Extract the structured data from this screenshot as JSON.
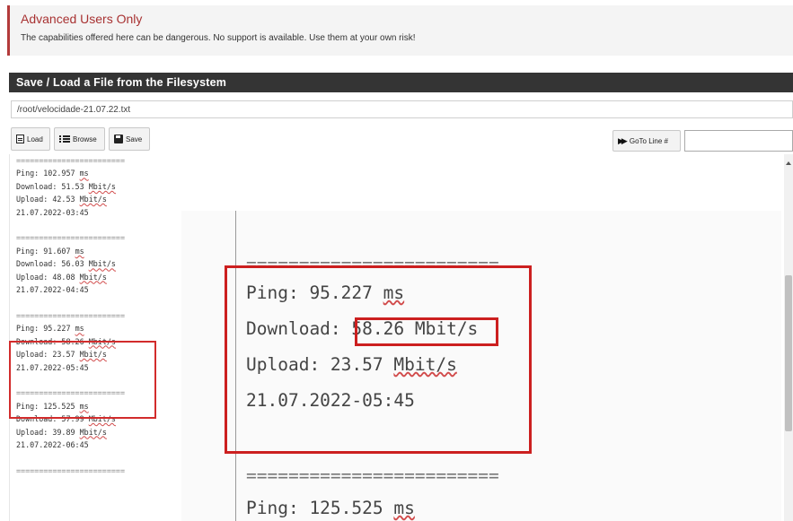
{
  "warning": {
    "title": "Advanced Users Only",
    "text": "The capabilities offered here can be dangerous. No support is available. Use them at your own risk!"
  },
  "panel": {
    "title": "Save / Load a File from the Filesystem"
  },
  "file_path": "/root/velocidade-21.07.22.txt",
  "toolbar": {
    "load_label": "Load",
    "browse_label": "Browse",
    "save_label": "Save",
    "goto_label": "GoTo Line #",
    "goto_value": ""
  },
  "editor": {
    "separator": "========================",
    "entries": [
      {
        "ping": "Ping: 102.957",
        "download": "Download: 51.53",
        "upload": "Upload: 42.53",
        "date": "21.07.2022-03:45"
      },
      {
        "ping": "Ping: 91.607",
        "download": "Download: 56.03",
        "upload": "Upload: 48.08",
        "date": "21.07.2022-04:45"
      },
      {
        "ping": "Ping: 95.227",
        "download": "Download: 58.26",
        "upload": "Upload: 23.57",
        "date": "21.07.2022-05:45"
      },
      {
        "ping": "Ping: 125.525",
        "download": "Download: 57.99",
        "upload": "Upload: 39.89",
        "date": "21.07.2022-06:45"
      }
    ],
    "unit_ms": "ms",
    "unit_mbit": "Mbit/s"
  },
  "zoom": {
    "separator": "========================",
    "ping_label": "Ping: 95.227",
    "ping_unit": "ms",
    "download_label": "Download:",
    "download_value": "58.26 Mbit/s",
    "upload_label": "Upload: 23.57",
    "upload_unit": "Mbit/s",
    "date": "21.07.2022-05:45",
    "next_ping_label": "Ping: 125.525",
    "next_ping_unit": "ms"
  },
  "colors": {
    "warning_title": "#a83232",
    "panel_heading_bg": "#343434",
    "highlight_red": "#cc1f1f"
  }
}
